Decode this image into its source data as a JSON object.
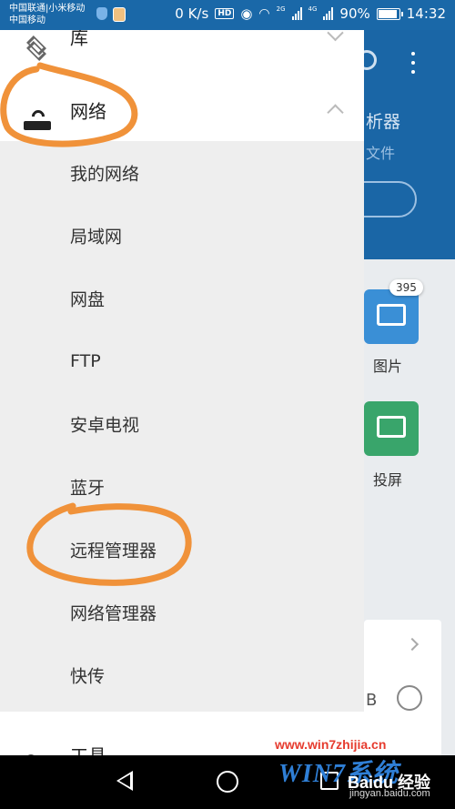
{
  "status_bar": {
    "carrier_line1": "中国联通|小米移动",
    "carrier_line2": "中国移动",
    "speed": "0 K/s",
    "hd": "HD",
    "net_2g": "2G",
    "net_4g": "4G",
    "battery": "90%",
    "battery_level": 0.9,
    "time": "14:32"
  },
  "drawer": {
    "top_item": {
      "label": "库",
      "icon": "layers-icon",
      "state": "collapsed"
    },
    "network_header": {
      "label": "网络",
      "icon": "router-icon",
      "state": "expanded"
    },
    "network_items": [
      {
        "label": "我的网络"
      },
      {
        "label": "局域网"
      },
      {
        "label": "网盘"
      },
      {
        "label": "FTP"
      },
      {
        "label": "安卓电视"
      },
      {
        "label": "蓝牙"
      },
      {
        "label": "远程管理器"
      },
      {
        "label": "网络管理器"
      },
      {
        "label": "快传"
      }
    ],
    "bottom_item": {
      "label": "工具",
      "icon": "wrench-icon"
    }
  },
  "background_app": {
    "title_partial": "析器",
    "subtitle_partial": "文件",
    "tiles": [
      {
        "label": "图片",
        "badge": "395",
        "icon": "image-icon"
      },
      {
        "label": "投屏",
        "icon": "cast-icon"
      }
    ],
    "card_text": "B"
  },
  "watermark": {
    "url": "www.win7zhijia.cn",
    "logo": "WIN7系统",
    "baidu": "Baidu 经验",
    "jingyan": "jingyan.baidu.com"
  },
  "colors": {
    "status_bar": "#1a68a8",
    "drawer_bg": "#ffffff",
    "submenu_bg": "#eeeeee",
    "annotation": "#f0923a",
    "tile_pictures": "#3a8fd6",
    "tile_cast": "#39a56b"
  }
}
